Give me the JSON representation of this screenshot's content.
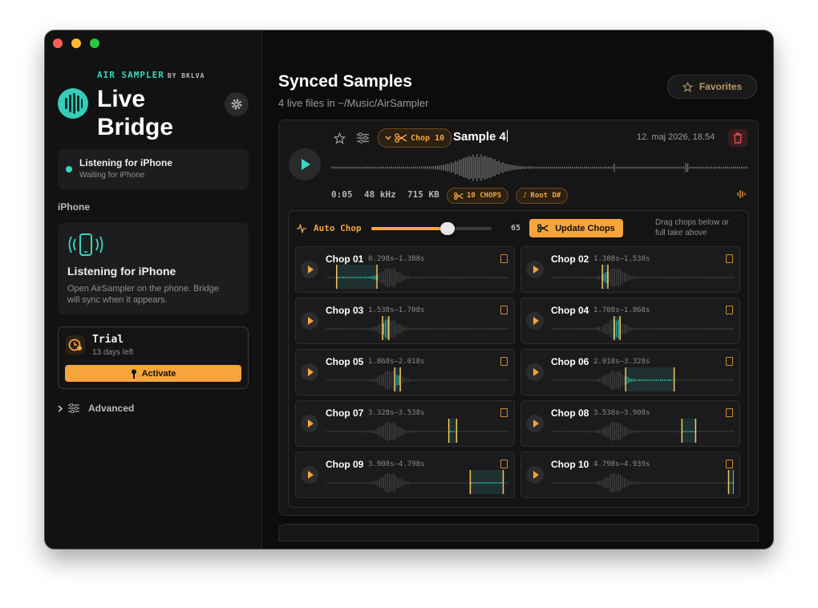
{
  "colors": {
    "accent": "#f5a53c",
    "teal": "#3ad6c0",
    "delete": "#d23a3a"
  },
  "sidebar": {
    "brand": "AIR SAMPLER",
    "brand_by": "BY BKLVA",
    "title_line1": "Live",
    "title_line2": "Bridge",
    "status": {
      "title": "Listening for iPhone",
      "subtitle": "Waiting for iPhone"
    },
    "section_label": "iPhone",
    "iphone_card": {
      "title": "Listening for iPhone",
      "body_line1": "Open AirSampler on the phone. Bridge",
      "body_line2": "will sync when it appears."
    },
    "trial": {
      "title": "Trial",
      "subtitle": "13 days left",
      "button": "Activate"
    },
    "advanced": "Advanced"
  },
  "main": {
    "title": "Synced Samples",
    "subtitle": "4 live files in ~/Music/AirSampler",
    "favorites": "Favorites",
    "sample": {
      "chop_pill": "Chop 10",
      "name": "Sample 4",
      "date": "12. maj 2026, 18.54",
      "duration": "0:05",
      "rate": "48 kHz",
      "size": "715 KB",
      "chops_badge": "10 CHOPS",
      "root_badge": "Root D#"
    },
    "auto_chop": {
      "label": "Auto Chop",
      "value": "65",
      "slider_fraction": 0.63,
      "update": "Update Chops",
      "hint_line1": "Drag chops below or",
      "hint_line2": "full take above"
    },
    "chops": [
      {
        "name": "Chop 01",
        "time": "0.298s–1.388s"
      },
      {
        "name": "Chop 02",
        "time": "1.388s–1.538s"
      },
      {
        "name": "Chop 03",
        "time": "1.538s–1.708s"
      },
      {
        "name": "Chop 04",
        "time": "1.708s–1.868s"
      },
      {
        "name": "Chop 05",
        "time": "1.868s–2.018s"
      },
      {
        "name": "Chop 06",
        "time": "2.018s–3.328s"
      },
      {
        "name": "Chop 07",
        "time": "3.328s–3.538s"
      },
      {
        "name": "Chop 08",
        "time": "3.538s–3.908s"
      },
      {
        "name": "Chop 09",
        "time": "3.908s–4.798s"
      },
      {
        "name": "Chop 10",
        "time": "4.798s–4.939s"
      }
    ]
  }
}
